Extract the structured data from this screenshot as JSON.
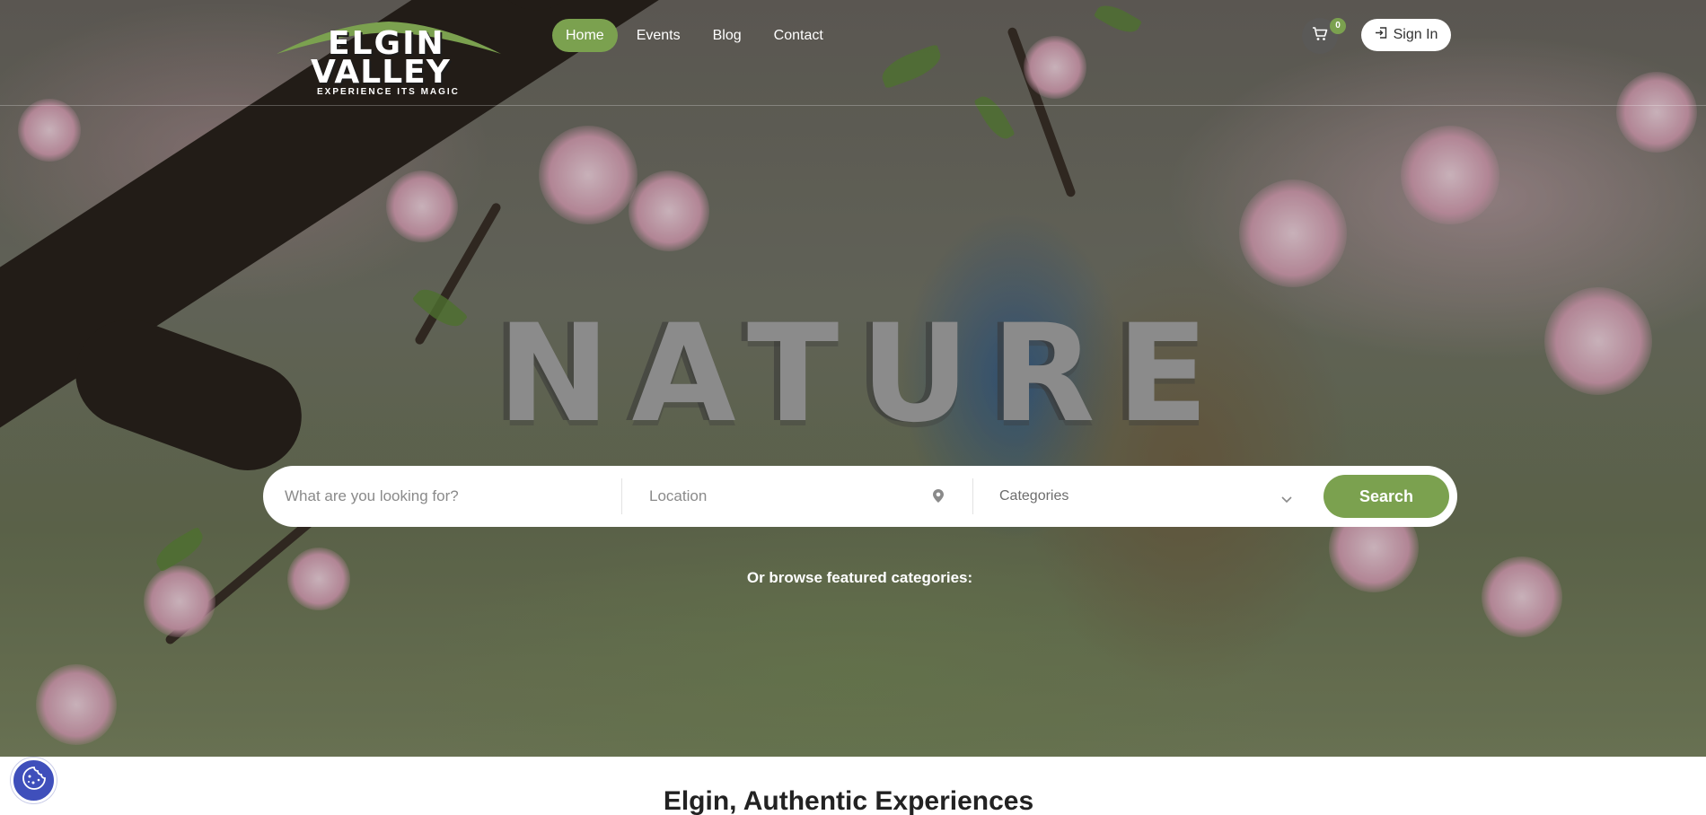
{
  "brand": {
    "name_line1": "ELGIN",
    "name_line2": "VALLEY",
    "tagline": "EXPERIENCE ITS MAGIC",
    "accent_color": "#7ba14f"
  },
  "nav": {
    "items": [
      {
        "label": "Home",
        "active": true
      },
      {
        "label": "Events",
        "active": false
      },
      {
        "label": "Blog",
        "active": false
      },
      {
        "label": "Contact",
        "active": false
      }
    ]
  },
  "cart": {
    "icon": "cart-icon",
    "count": "0"
  },
  "signin": {
    "icon": "sign-in-icon",
    "label": "Sign In"
  },
  "hero": {
    "word": "NATURE"
  },
  "search": {
    "query_placeholder": "What are you looking for?",
    "location_placeholder": "Location",
    "location_icon": "map-pin-icon",
    "categories_label": "Categories",
    "categories_icon": "chevron-down-icon",
    "button_label": "Search"
  },
  "browse": {
    "label": "Or browse featured categories:"
  },
  "section": {
    "title": "Elgin, Authentic Experiences"
  },
  "cookie": {
    "icon": "cookie-icon"
  }
}
